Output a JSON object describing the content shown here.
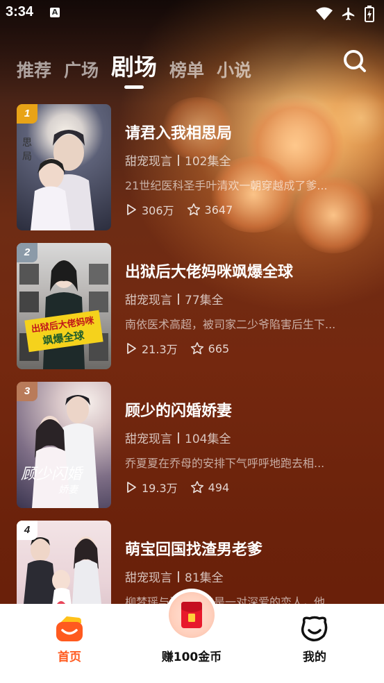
{
  "status_bar": {
    "time": "3:34",
    "notification_letter": "A",
    "icons": [
      "wifi-icon",
      "airplane-mode-icon",
      "battery-charging-icon"
    ]
  },
  "top_tabs": [
    {
      "label": "推荐",
      "active": false
    },
    {
      "label": "广场",
      "active": false
    },
    {
      "label": "剧场",
      "active": true
    },
    {
      "label": "榜单",
      "active": false
    },
    {
      "label": "小说",
      "active": false
    }
  ],
  "search": {
    "icon": "search-icon"
  },
  "dramas": [
    {
      "rank": "1",
      "title": "请君入我相思局",
      "genre": "甜宠现言",
      "episodes": "102集全",
      "description": "21世纪医科圣手叶清欢一朝穿越成了爹...",
      "plays": "306万",
      "favorites": "3647",
      "rank_color": "#e8a317"
    },
    {
      "rank": "2",
      "title": "出狱后大佬妈咪飒爆全球",
      "genre": "甜宠现言",
      "episodes": "77集全",
      "description": "南依医术高超，被司家二少爷陷害后生下...",
      "plays": "21.3万",
      "favorites": "665",
      "rank_color": "#8b9aa8"
    },
    {
      "rank": "3",
      "title": "顾少的闪婚娇妻",
      "genre": "甜宠现言",
      "episodes": "104集全",
      "description": "乔夏夏在乔母的安排下气呼呼地跑去相...",
      "plays": "19.3万",
      "favorites": "494",
      "rank_color": "#b97b5a"
    },
    {
      "rank": "4",
      "title": "萌宝回国找渣男老爹",
      "genre": "甜宠现言",
      "episodes": "81集全",
      "description": "柳梦瑶与沈之言曾是一对深爱的恋人，他...",
      "plays": "",
      "favorites": "",
      "rank_color": "#ffffff"
    }
  ],
  "bottom_nav": {
    "home": {
      "label": "首页",
      "icon": "home-icon",
      "active": true
    },
    "earn": {
      "label": "赚100金币",
      "icon": "red-envelope-icon"
    },
    "mine": {
      "label": "我的",
      "icon": "smiley-face-icon"
    }
  },
  "colors": {
    "accent": "#ff5a1f",
    "background": "#6e2c14"
  }
}
